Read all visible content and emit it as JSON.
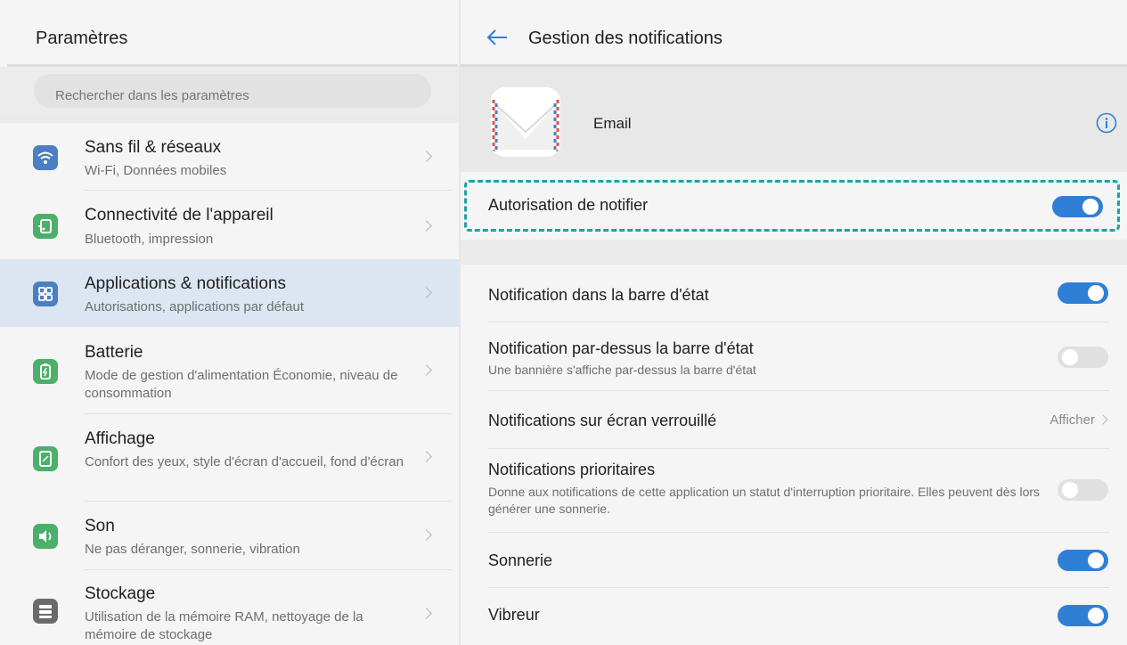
{
  "left": {
    "title": "Paramètres",
    "search_placeholder": "Rechercher dans les paramètres",
    "items": [
      {
        "title": "Sans fil & réseaux",
        "subtitle": "Wi-Fi, Données mobiles",
        "icon": "wifi-icon",
        "color": "#4a7fc1"
      },
      {
        "title": "Connectivité de l'appareil",
        "subtitle": "Bluetooth, impression",
        "icon": "device-connectivity-icon",
        "color": "#4caf6a"
      },
      {
        "title": "Applications & notifications",
        "subtitle": "Autorisations, applications par défaut",
        "icon": "apps-grid-icon",
        "color": "#4a7fc1",
        "active": true
      },
      {
        "title": "Batterie",
        "subtitle": "Mode de gestion d'alimentation Économie, niveau de consommation",
        "icon": "battery-icon",
        "color": "#4caf6a"
      },
      {
        "title": "Affichage",
        "subtitle": "Confort des yeux, style d'écran d'accueil, fond d'écran",
        "icon": "display-icon",
        "color": "#4caf6a"
      },
      {
        "title": "Son",
        "subtitle": "Ne pas déranger, sonnerie, vibration",
        "icon": "speaker-icon",
        "color": "#4caf6a"
      },
      {
        "title": "Stockage",
        "subtitle": "Utilisation de la mémoire RAM, nettoyage de la mémoire de stockage",
        "icon": "storage-icon",
        "color": "#6a6a6a"
      }
    ]
  },
  "right": {
    "title": "Gestion des notifications",
    "app_name": "Email",
    "permission_label": "Autorisation de notifier",
    "permission_on": true,
    "highlight_color": "#1fa3a3",
    "toggle_on_color": "#2f7fd6",
    "rows": [
      {
        "title": "Notification dans la barre d'état",
        "subtitle": "",
        "type": "toggle",
        "on": true
      },
      {
        "title": "Notification par-dessus la barre d'état",
        "subtitle": "Une bannière s'affiche par-dessus la barre d'état",
        "type": "toggle",
        "on": false
      },
      {
        "title": "Notifications sur écran verrouillé",
        "subtitle": "",
        "type": "value",
        "value": "Afficher"
      },
      {
        "title": "Notifications prioritaires",
        "subtitle": "Donne aux notifications de cette application un statut d'interruption prioritaire. Elles peuvent dès lors générer une sonnerie.",
        "type": "toggle",
        "on": false
      },
      {
        "title": "Sonnerie",
        "subtitle": "",
        "type": "toggle",
        "on": true
      },
      {
        "title": "Vibreur",
        "subtitle": "",
        "type": "toggle",
        "on": true
      }
    ]
  }
}
